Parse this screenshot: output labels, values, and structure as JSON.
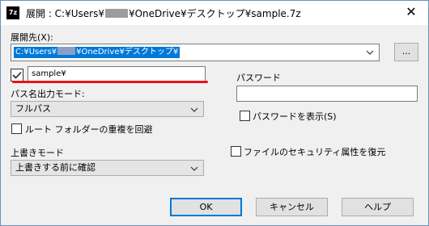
{
  "window": {
    "app_icon_text": "7z",
    "title_prefix": "展開 : C:¥Users¥",
    "title_suffix": "¥OneDrive¥デスクトップ¥sample.7z",
    "close_label": "✕"
  },
  "extract_to": {
    "label": "展開先(X):",
    "path_prefix": "C:¥Users¥",
    "path_suffix": "¥OneDrive¥デスクトップ¥",
    "browse_label": "..."
  },
  "subfolder": {
    "checked": true,
    "value": "sample¥"
  },
  "path_mode": {
    "label": "パス名出力モード:",
    "selected": "フルパス"
  },
  "eliminate_duplication": {
    "label": "ルート フォルダーの重複を回避",
    "checked": false
  },
  "overwrite_mode": {
    "label": "上書きモード",
    "selected": "上書きする前に確認"
  },
  "password": {
    "label": "パスワード",
    "value": "",
    "show_label": "パスワードを表示(S)",
    "show_checked": false
  },
  "restore_security": {
    "label": "ファイルのセキュリティ属性を復元",
    "checked": false
  },
  "buttons": {
    "ok": "OK",
    "cancel": "キャンセル",
    "help": "ヘルプ"
  },
  "colors": {
    "selection": "#0078d7",
    "annotation_underline": "#e8131c",
    "dialog_background": "#f0f0f0"
  }
}
